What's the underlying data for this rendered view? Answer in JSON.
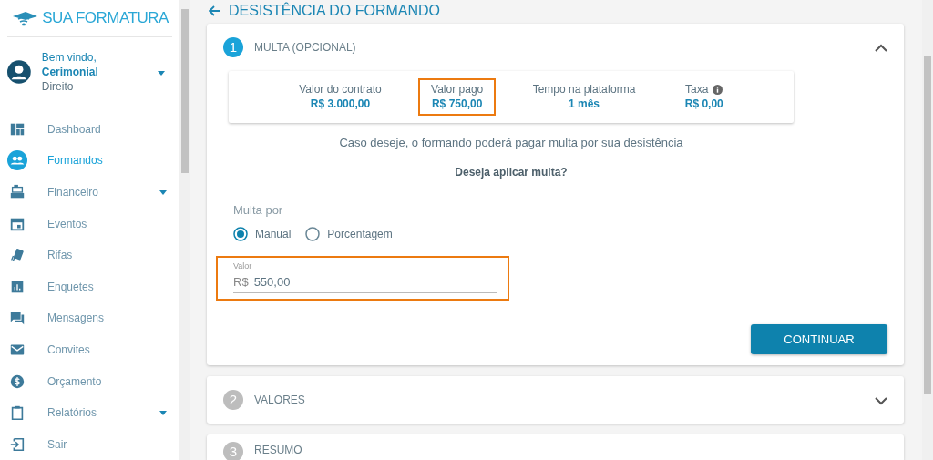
{
  "logo": {
    "text": "SUA FORMATURA"
  },
  "user": {
    "greeting": "Bem vindo, **Cerimonial**",
    "subtitle": "Direito"
  },
  "sidebar": {
    "items": [
      {
        "label": "Dashboard",
        "selected": false,
        "expandable": false
      },
      {
        "label": "Formandos",
        "selected": true,
        "expandable": false
      },
      {
        "label": "Financeiro",
        "selected": false,
        "expandable": true
      },
      {
        "label": "Eventos",
        "selected": false,
        "expandable": false
      },
      {
        "label": "Rifas",
        "selected": false,
        "expandable": false
      },
      {
        "label": "Enquetes",
        "selected": false,
        "expandable": false
      },
      {
        "label": "Mensagens",
        "selected": false,
        "expandable": false
      },
      {
        "label": "Convites",
        "selected": false,
        "expandable": false
      },
      {
        "label": "Orçamento",
        "selected": false,
        "expandable": false
      },
      {
        "label": "Relatórios",
        "selected": false,
        "expandable": true
      },
      {
        "label": "Sair",
        "selected": false,
        "expandable": false
      }
    ]
  },
  "page": {
    "title": "DESISTÊNCIA DO FORMANDO"
  },
  "steps": [
    {
      "number": "1",
      "title": "MULTA (OPCIONAL)",
      "expanded": true
    },
    {
      "number": "2",
      "title": "VALORES",
      "expanded": false
    },
    {
      "number": "3",
      "title": "RESUMO",
      "expanded": false
    }
  ],
  "summary": [
    {
      "label": "Valor do contrato",
      "value": "R$ 3.000,00",
      "highlighted": false,
      "info": false
    },
    {
      "label": "Valor pago",
      "value": "R$ 750,00",
      "highlighted": true,
      "info": false
    },
    {
      "label": "Tempo na plataforma",
      "value": "1 mês",
      "highlighted": false,
      "info": false
    },
    {
      "label": "Taxa",
      "value": "R$ 0,00",
      "highlighted": false,
      "info": true
    }
  ],
  "caption": "Caso deseje, o formando poderá pagar multa por sua desistência",
  "question": "Deseja aplicar multa?",
  "multa_por": {
    "label": "Multa por",
    "options": [
      {
        "label": "Manual",
        "selected": true
      },
      {
        "label": "Porcentagem",
        "selected": false
      }
    ]
  },
  "valor_field": {
    "label": "Valor",
    "prefix": "R$",
    "value": "550,00",
    "highlighted": true
  },
  "continue_button": "CONTINUAR"
}
